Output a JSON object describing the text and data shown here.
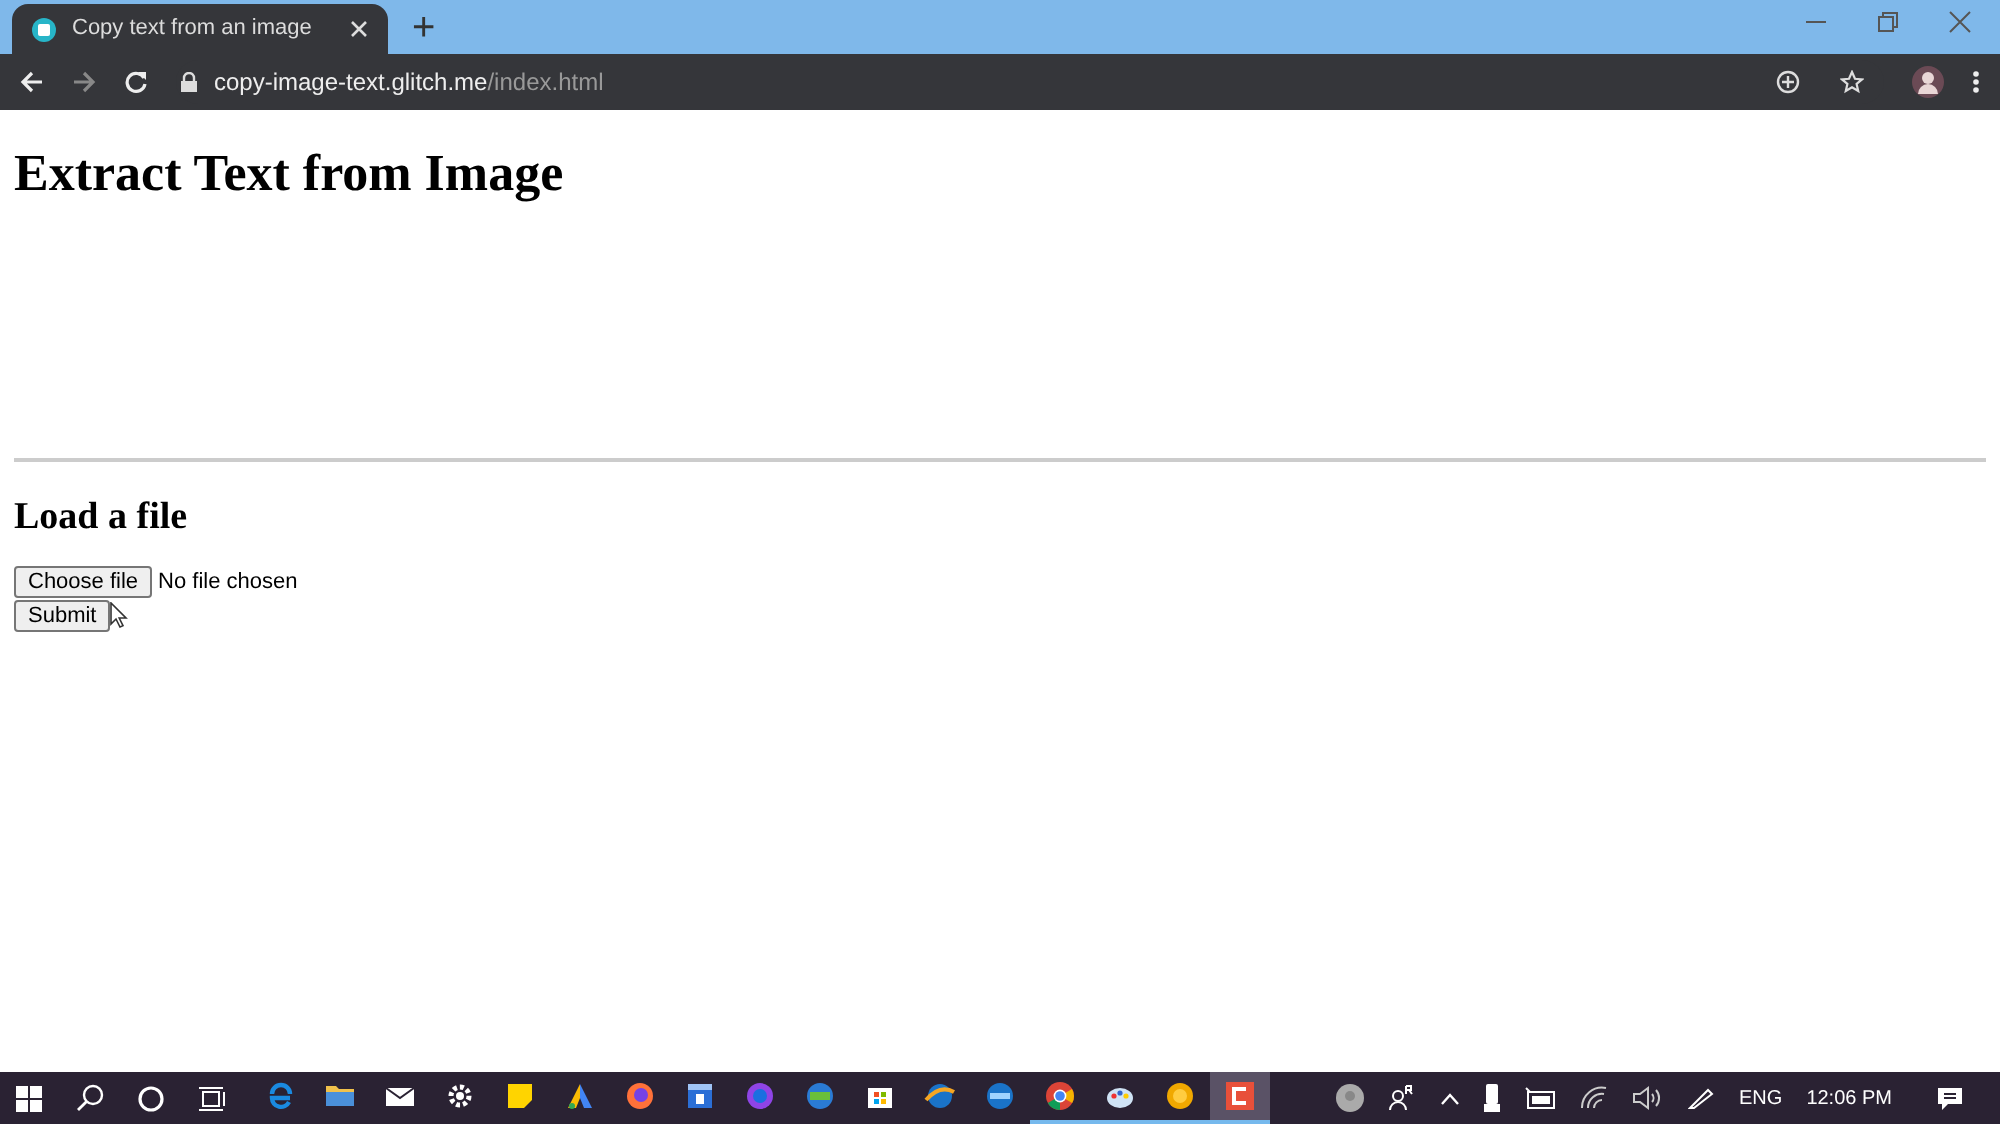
{
  "browser": {
    "tab_title": "Copy text from an image",
    "url_host": "copy-image-text.glitch.me",
    "url_path": "/index.html",
    "new_tab": "+"
  },
  "page": {
    "heading": "Extract Text from Image",
    "subheading": "Load a file",
    "choose_button": "Choose file",
    "file_status": "No file chosen",
    "submit_button": "Submit"
  },
  "taskbar": {
    "apps": [
      {
        "kind": "e",
        "running": false,
        "selected": false
      },
      {
        "kind": "folder",
        "running": false,
        "selected": false
      },
      {
        "kind": "mail",
        "running": false,
        "selected": false
      },
      {
        "kind": "gear",
        "running": false,
        "selected": false
      },
      {
        "kind": "note",
        "running": false,
        "selected": false
      },
      {
        "kind": "triangle",
        "running": false,
        "selected": false
      },
      {
        "kind": "fox",
        "running": false,
        "selected": false
      },
      {
        "kind": "calendar",
        "running": false,
        "selected": false
      },
      {
        "kind": "purple",
        "running": false,
        "selected": false
      },
      {
        "kind": "green",
        "running": false,
        "selected": false
      },
      {
        "kind": "store",
        "running": false,
        "selected": false
      },
      {
        "kind": "orange",
        "running": false,
        "selected": false
      },
      {
        "kind": "blue",
        "running": false,
        "selected": false
      },
      {
        "kind": "chrome",
        "running": true,
        "selected": false
      },
      {
        "kind": "palette",
        "running": true,
        "selected": false
      },
      {
        "kind": "coin",
        "running": true,
        "selected": false
      },
      {
        "kind": "c",
        "running": true,
        "selected": true
      }
    ],
    "language": "ENG",
    "time": "12:06 PM"
  }
}
